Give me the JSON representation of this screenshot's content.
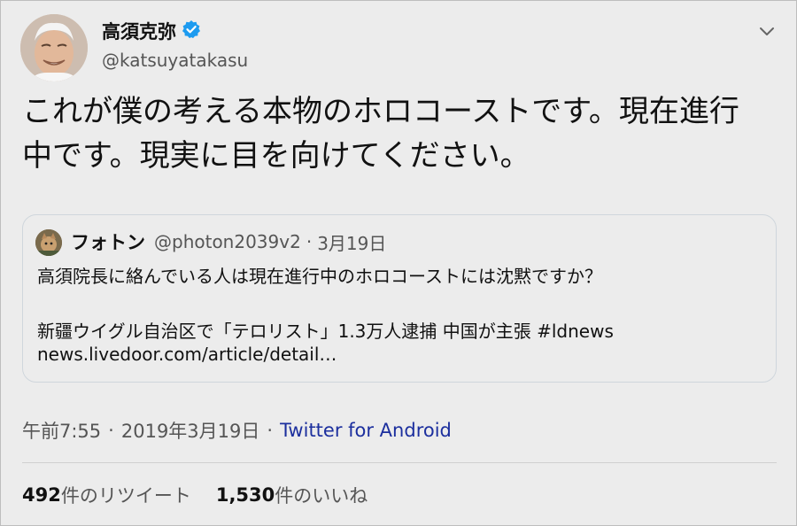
{
  "author": {
    "name": "高須克弥",
    "handle": "@katsuyatakasu",
    "verified": true
  },
  "tweet": {
    "line1": "これが僕の考える本物のホロコーストです。現在進行",
    "line2": "中です。現実に目を向けてください。"
  },
  "quote": {
    "name": "フォトン",
    "handle": "@photon2039v2",
    "separator": "·",
    "date": "3月19日",
    "line1": "高須院長に絡んでいる人は現在進行中のホロコーストには沈黙ですか？",
    "line2": "新疆ウイグル自治区で「テロリスト」1.3万人逮捕 中国が主張 #ldnews",
    "line3": "news.livedoor.com/article/detail…"
  },
  "meta": {
    "time": "午前7:55",
    "separator": "·",
    "date": "2019年3月19日",
    "source": "Twitter for Android"
  },
  "stats": {
    "retweets_count": "492",
    "retweets_label": "件のリツイート",
    "likes_count": "1,530",
    "likes_label": "件のいいね"
  },
  "colors": {
    "background": "#ececec",
    "verified_badge": "#1d9bf0",
    "source_link": "#1c2f9e",
    "secondary_text": "#555555"
  },
  "icons": [
    "avatar",
    "verified-badge-icon",
    "chevron-down-icon",
    "quote-avatar"
  ]
}
